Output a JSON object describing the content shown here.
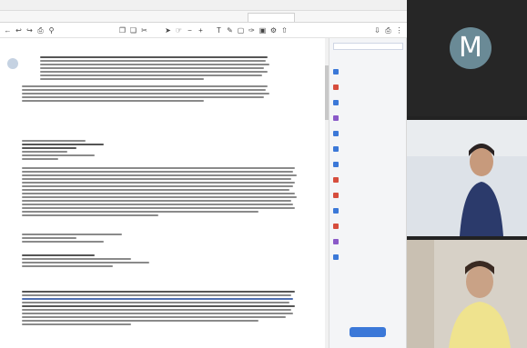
{
  "window": {
    "title": ""
  },
  "tabs": [
    {
      "label": "",
      "active": false
    },
    {
      "label": "",
      "active": false
    },
    {
      "label": "",
      "active": false
    },
    {
      "label": "",
      "active": false
    },
    {
      "label": "",
      "active": false
    },
    {
      "label": "",
      "active": true
    },
    {
      "label": "",
      "active": false
    },
    {
      "label": "",
      "active": false
    }
  ],
  "mail": {
    "subject": ""
  },
  "sidebar": {
    "search_placeholder": "",
    "items": [
      {
        "label": "",
        "icon": "file-icon",
        "color": "#3b78d8"
      },
      {
        "label": "",
        "icon": "file-icon",
        "color": "#d64d3d"
      },
      {
        "label": "",
        "icon": "file-icon",
        "color": "#3b78d8"
      },
      {
        "label": "",
        "icon": "calendar-icon",
        "color": "#8a59c8"
      },
      {
        "label": "",
        "icon": "document-icon",
        "color": "#3b78d8"
      },
      {
        "label": "",
        "icon": "folder-icon",
        "color": "#3b78d8"
      },
      {
        "label": "",
        "icon": "file-icon",
        "color": "#3b78d8"
      },
      {
        "label": "",
        "icon": "file-icon",
        "color": "#d64d3d"
      },
      {
        "label": "",
        "icon": "image-icon",
        "color": "#d64d3d"
      },
      {
        "label": "",
        "icon": "user-icon",
        "color": "#3b78d8"
      },
      {
        "label": "",
        "icon": "pencil-icon",
        "color": "#d64d3d"
      },
      {
        "label": "",
        "icon": "settings-icon",
        "color": "#8a59c8"
      },
      {
        "label": "",
        "icon": "user-icon",
        "color": "#3b78d8"
      }
    ],
    "footer_text": "",
    "button_label": ""
  },
  "video": {
    "participants": [
      {
        "name": "",
        "initial": "M"
      },
      {
        "name": ""
      },
      {
        "name": ""
      }
    ]
  }
}
